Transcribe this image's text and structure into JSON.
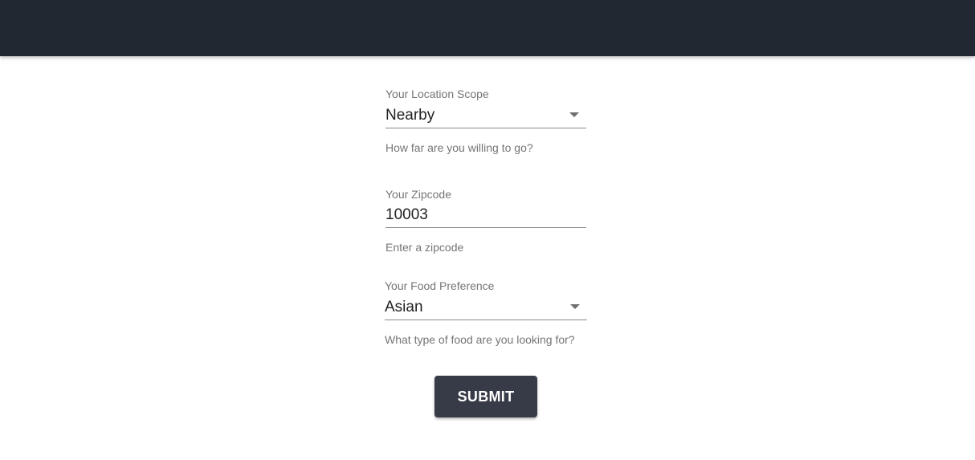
{
  "form": {
    "location_scope": {
      "label": "Your Location Scope",
      "value": "Nearby",
      "helper": "How far are you willing to go?"
    },
    "zipcode": {
      "label": "Your Zipcode",
      "value": "10003",
      "helper": "Enter a zipcode"
    },
    "food_preference": {
      "label": "Your Food Preference",
      "value": "Asian",
      "helper": "What type of food are you looking for?"
    },
    "submit_label": "SUBMIT"
  },
  "colors": {
    "app_bar": "#222832",
    "button": "#363b47",
    "label": "#757575",
    "text": "#222222"
  },
  "icons": {
    "dropdown": "caret-down-icon"
  }
}
